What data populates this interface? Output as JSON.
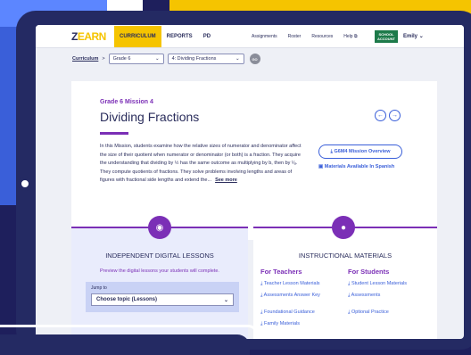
{
  "nav": {
    "logo_mark": "Z",
    "logo_text": "EARN",
    "items": [
      "CURRICULUM",
      "REPORTS",
      "PD"
    ],
    "right_items": [
      "Assignments",
      "Roster",
      "Resources",
      "Help"
    ],
    "school_line1": "SCHOOL",
    "school_line2": "ACCOUNT",
    "user": "Emily"
  },
  "breadcrumb": {
    "root": "Curriculum",
    "sep": ">",
    "grade": "Grade 6",
    "mission": "4: Dividing Fractions",
    "go": "GO"
  },
  "mission": {
    "eyebrow": "Grade 6 Mission 4",
    "title": "Dividing Fractions",
    "description": "In this Mission, students examine how the relative sizes of numerator and denominator affect the size of their quotient when numerator or denominator (or both) is a fraction. They acquire the understanding that dividing by ½ has the same outcome as multiplying by b, then by ¹⁄ₐ. They compute quotients of fractions. They solve problems involving lengths and areas of figures with fractional side lengths and extend the...",
    "see_more": "See more",
    "overview_btn": "G6M4 Mission Overview",
    "spanish": "Materials Available In Spanish"
  },
  "lessons": {
    "heading": "INDEPENDENT DIGITAL LESSONS",
    "sub": "Preview the digital lessons your students will complete.",
    "jump_label": "Jump to",
    "jump_value": "Choose topic (Lessons)"
  },
  "materials": {
    "heading": "INSTRUCTIONAL MATERIALS",
    "teachers_h": "For Teachers",
    "teachers": [
      "Teacher Lesson Materials",
      "Assessments Answer Key",
      "Foundational Guidance",
      "Family Materials"
    ],
    "students_h": "For Students",
    "students": [
      "Student Lesson Materials",
      "Assessments",
      "Optional Practice"
    ]
  },
  "colors": {
    "accent": "#7b2fb6",
    "brand_yellow": "#f5c400",
    "link": "#3a5fd9",
    "frame": "#242a63"
  }
}
